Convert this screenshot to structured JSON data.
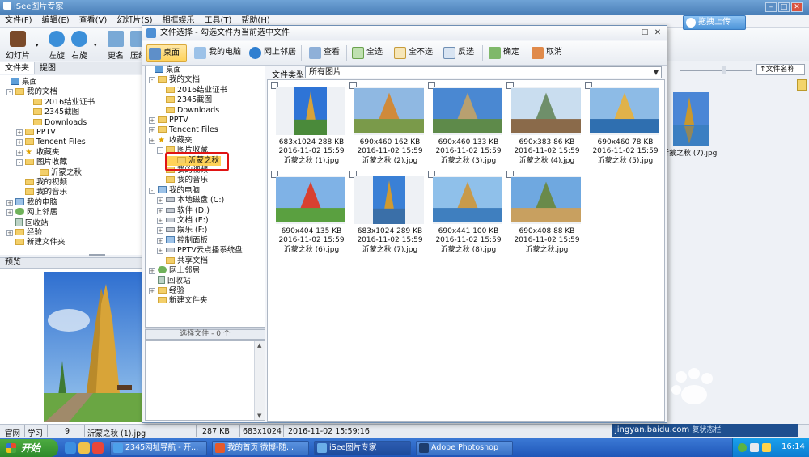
{
  "app": {
    "title": "iSee图片专家",
    "menu": [
      "文件(F)",
      "编辑(E)",
      "查看(V)",
      "幻灯片(S)",
      "相框娱乐",
      "工具(T)",
      "帮助(H)"
    ],
    "toolbar": [
      {
        "label": "幻灯片",
        "icon": "slideshow-icon"
      },
      {
        "label": "左旋",
        "icon": "rotate-left-icon"
      },
      {
        "label": "右旋",
        "icon": "rotate-right-icon"
      },
      {
        "label": "更名",
        "icon": "rename-icon"
      },
      {
        "label": "压缩",
        "icon": "compress-icon"
      }
    ],
    "upload_button": "拖拽上传",
    "left_tabs": [
      "文件夹",
      "提图"
    ],
    "preview_label": "预览",
    "sort_select": "↑文件名称",
    "background_thumb_caption": "沂蒙之秋 (7).jpg",
    "brand_colors": {
      "accent": "#4c93d8",
      "highlight": "#e01414",
      "selected": "#ffd258"
    }
  },
  "left_tree": [
    {
      "label": "桌面",
      "icon": "desktop-icon",
      "expander": ""
    },
    {
      "label": "我的文档",
      "icon": "folder-icon",
      "expander": "-"
    },
    {
      "label": "2016结业证书",
      "icon": "folder-icon",
      "expander": ""
    },
    {
      "label": "2345截图",
      "icon": "folder-icon",
      "expander": ""
    },
    {
      "label": "Downloads",
      "icon": "folder-icon",
      "expander": ""
    },
    {
      "label": "PPTV",
      "icon": "folder-icon",
      "expander": "+"
    },
    {
      "label": "Tencent Files",
      "icon": "folder-icon",
      "expander": "+"
    },
    {
      "label": "收藏夹",
      "icon": "favorites-icon",
      "expander": "+"
    },
    {
      "label": "图片收藏",
      "icon": "folder-icon",
      "expander": "-"
    },
    {
      "label": "沂蒙之秋",
      "icon": "folder-icon",
      "expander": ""
    },
    {
      "label": "我的视频",
      "icon": "folder-icon",
      "expander": ""
    },
    {
      "label": "我的音乐",
      "icon": "folder-icon",
      "expander": ""
    },
    {
      "label": "我的电脑",
      "icon": "computer-icon",
      "expander": "+"
    },
    {
      "label": "网上邻居",
      "icon": "network-icon",
      "expander": "+"
    },
    {
      "label": "回收站",
      "icon": "recycle-bin-icon",
      "expander": ""
    },
    {
      "label": "经验",
      "icon": "folder-icon",
      "expander": "+"
    },
    {
      "label": "新建文件夹",
      "icon": "folder-icon",
      "expander": ""
    }
  ],
  "status": {
    "items": [
      "官网",
      "学习",
      "9",
      "沂蒙之秋 (1).jpg",
      "287 KB",
      "683x1024",
      "2016-11-02 15:59:16"
    ],
    "watermark": "jingyan.baidu.com",
    "watermark_suffix": "复状态栏"
  },
  "taskbar": {
    "start": "开始",
    "items": [
      "2345网址导航 - 开...",
      "我的首页 微博-随...",
      "iSee图片专家",
      "Adobe Photoshop"
    ],
    "clock": "16:14"
  },
  "dialog": {
    "title": "文件选择 - 勾选文件为当前选中文件",
    "toolbar": [
      {
        "label": "桌面",
        "icon": "desktop-icon",
        "active": true
      },
      {
        "label": "我的电脑",
        "icon": "computer-icon"
      },
      {
        "label": "网上邻居",
        "icon": "network-icon"
      },
      {
        "label": "查看",
        "icon": "view-icon"
      },
      {
        "label": "全选",
        "icon": "select-all-icon"
      },
      {
        "label": "全不选",
        "icon": "select-none-icon"
      },
      {
        "label": "反选",
        "icon": "invert-selection-icon"
      },
      {
        "label": "确定",
        "icon": "confirm-icon"
      },
      {
        "label": "取消",
        "icon": "cancel-icon"
      }
    ],
    "tree": [
      {
        "label": "桌面",
        "icon": "desktop-icon",
        "expander": ""
      },
      {
        "label": "我的文档",
        "icon": "folder-icon",
        "expander": "-"
      },
      {
        "label": "2016结业证书",
        "icon": "folder-icon",
        "expander": ""
      },
      {
        "label": "2345截图",
        "icon": "folder-icon",
        "expander": ""
      },
      {
        "label": "Downloads",
        "icon": "folder-icon",
        "expander": ""
      },
      {
        "label": "PPTV",
        "icon": "folder-icon",
        "expander": "+"
      },
      {
        "label": "Tencent Files",
        "icon": "folder-icon",
        "expander": "+"
      },
      {
        "label": "收藏夹",
        "icon": "favorites-icon",
        "expander": "+"
      },
      {
        "label": "图片收藏",
        "icon": "folder-icon",
        "expander": "-"
      },
      {
        "label": "沂蒙之秋",
        "icon": "folder-icon",
        "expander": ""
      },
      {
        "label": "我的视频",
        "icon": "folder-icon",
        "expander": ""
      },
      {
        "label": "我的音乐",
        "icon": "folder-icon",
        "expander": ""
      },
      {
        "label": "我的电脑",
        "icon": "computer-icon",
        "expander": "-"
      },
      {
        "label": "本地磁盘 (C:)",
        "icon": "drive-icon",
        "expander": "+"
      },
      {
        "label": "软件 (D:)",
        "icon": "drive-icon",
        "expander": "+"
      },
      {
        "label": "文档 (E:)",
        "icon": "drive-icon",
        "expander": "+"
      },
      {
        "label": "娱乐 (F:)",
        "icon": "drive-icon",
        "expander": "+"
      },
      {
        "label": "控制面板",
        "icon": "control-panel-icon",
        "expander": "+"
      },
      {
        "label": "PPTV云点播系统盘",
        "icon": "drive-icon",
        "expander": "+"
      },
      {
        "label": "共享文档",
        "icon": "folder-icon",
        "expander": ""
      },
      {
        "label": "网上邻居",
        "icon": "network-icon",
        "expander": "+"
      },
      {
        "label": "回收站",
        "icon": "recycle-bin-icon",
        "expander": ""
      },
      {
        "label": "经验",
        "icon": "folder-icon",
        "expander": "+"
      },
      {
        "label": "新建文件夹",
        "icon": "folder-icon",
        "expander": ""
      }
    ],
    "selected_files_label": "选择文件 - 0 个",
    "file_type_label": "文件类型",
    "file_type_value": "所有图片",
    "files": [
      {
        "dims": "683x1024",
        "size": "288 KB",
        "date": "2016-11-02 15:59",
        "name": "沂蒙之秋 (1).jpg",
        "portrait": true
      },
      {
        "dims": "690x460",
        "size": "162 KB",
        "date": "2016-11-02 15:59",
        "name": "沂蒙之秋 (2).jpg"
      },
      {
        "dims": "690x460",
        "size": "133 KB",
        "date": "2016-11-02 15:59",
        "name": "沂蒙之秋 (3).jpg"
      },
      {
        "dims": "690x383",
        "size": "86 KB",
        "date": "2016-11-02 15:59",
        "name": "沂蒙之秋 (4).jpg"
      },
      {
        "dims": "690x460",
        "size": "78 KB",
        "date": "2016-11-02 15:59",
        "name": "沂蒙之秋 (5).jpg"
      },
      {
        "dims": "690x404",
        "size": "135 KB",
        "date": "2016-11-02 15:59",
        "name": "沂蒙之秋 (6).jpg"
      },
      {
        "dims": "683x1024",
        "size": "289 KB",
        "date": "2016-11-02 15:59",
        "name": "沂蒙之秋 (7).jpg",
        "portrait": true
      },
      {
        "dims": "690x441",
        "size": "100 KB",
        "date": "2016-11-02 15:59",
        "name": "沂蒙之秋 (8).jpg"
      },
      {
        "dims": "690x408",
        "size": "88 KB",
        "date": "2016-11-02 15:59",
        "name": "沂蒙之秋.jpg"
      }
    ]
  }
}
